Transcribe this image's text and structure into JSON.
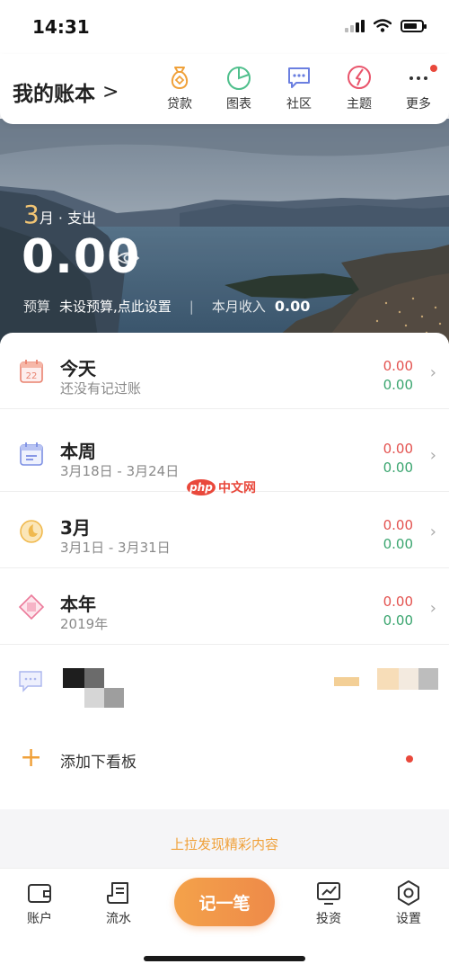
{
  "status_bar": {
    "time": "14:31"
  },
  "header": {
    "book_title": "我的账本",
    "book_chevron": ">",
    "nav": [
      {
        "label": "贷款",
        "icon": "loan-bag-icon",
        "color": "#f0a13a"
      },
      {
        "label": "图表",
        "icon": "pie-chart-icon",
        "color": "#4fbf8c"
      },
      {
        "label": "社区",
        "icon": "community-chat-icon",
        "color": "#6b7fe0"
      },
      {
        "label": "主题",
        "icon": "theme-palette-icon",
        "color": "#e9546b"
      },
      {
        "label": "更多",
        "icon": "more-dots-icon",
        "color": "#333333"
      }
    ]
  },
  "hero": {
    "month": "3",
    "month_suffix": "月 · 支出",
    "expense_amount": "0.00",
    "budget_key": "预算",
    "budget_value": "未设预算,点此设置",
    "separator": "|",
    "income_key": "本月收入",
    "income_value": "0.00"
  },
  "periods": [
    {
      "title": "今天",
      "sub": "还没有记过账",
      "expense": "0.00",
      "income": "0.00",
      "icon": "calendar-day-icon",
      "day": "22"
    },
    {
      "title": "本周",
      "sub": "3月18日 - 3月24日",
      "expense": "0.00",
      "income": "0.00",
      "icon": "calendar-week-icon"
    },
    {
      "title": "3月",
      "sub": "3月1日 - 3月31日",
      "expense": "0.00",
      "income": "0.00",
      "icon": "moon-month-icon"
    },
    {
      "title": "本年",
      "sub": "2019年",
      "expense": "0.00",
      "income": "0.00",
      "icon": "diamond-year-icon"
    }
  ],
  "watermark": {
    "php": "php",
    "text": "中文网"
  },
  "add_board": {
    "plus": "+",
    "label": "添加下看板"
  },
  "pull_hint": "上拉发现精彩内容",
  "tabbar": {
    "accounts": "账户",
    "flow": "流水",
    "record": "记一笔",
    "invest": "投资",
    "settings": "设置"
  },
  "colors": {
    "accent": "#f0a13a",
    "expense": "#e3524f",
    "income": "#3aa56f"
  }
}
